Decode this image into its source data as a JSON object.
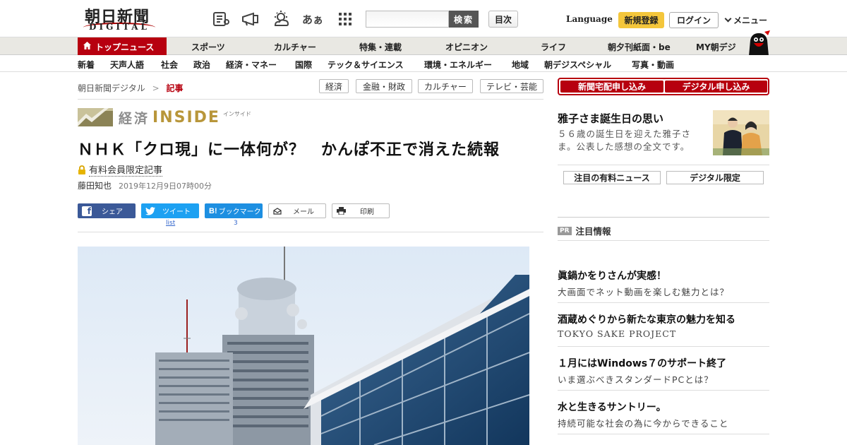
{
  "header": {
    "logo_main": "朝日新聞",
    "logo_sub": "DIGITAL",
    "hiragana_icon": "あぁ",
    "search_button": "検索",
    "toc_button": "目次",
    "language": "Language",
    "signup": "新規登録",
    "login": "ログイン",
    "menu": "メニュー"
  },
  "nav_primary": {
    "active": "トップニュース",
    "items": [
      "スポーツ",
      "カルチャー",
      "特集・連載",
      "オピニオン",
      "ライフ",
      "朝夕刊紙面・be",
      "MY朝デジ"
    ]
  },
  "nav_secondary": {
    "items": [
      "新着",
      "天声人語",
      "社会",
      "政治",
      "経済・マネー",
      "国際",
      "テック＆サイエンス",
      "環境・エネルギー",
      "地域",
      "朝デジスペシャル",
      "写真・動画"
    ]
  },
  "breadcrumb": {
    "home": "朝日新聞デジタル",
    "sep": ">",
    "current": "記事"
  },
  "tags": [
    "経済",
    "金融・財政",
    "カルチャー",
    "テレビ・芸能"
  ],
  "article": {
    "section_label": "経済",
    "section_brand": "INSIDE",
    "section_kana": "インサイド",
    "title": "ＮＨＫ「クロ現」に一体何が？　かんぽ不正で消えた続報",
    "paid_label": "有料会員限定記事",
    "author": "藤田知也",
    "date": "2019年12月9日07時00分"
  },
  "share": {
    "facebook": "シェア",
    "twitter": "ツイート",
    "hatena_logo": "B!",
    "hatena": "ブックマーク",
    "mail": "メール",
    "print": "印刷",
    "twitter_count": "list",
    "hatena_count": "3"
  },
  "sidebar": {
    "subscribe_paper": "新聞宅配申し込み",
    "subscribe_digital": "デジタル申し込み",
    "feature": {
      "title": "雅子さま誕生日の思い",
      "desc": "５６歳の誕生日を迎えた雅子さま。公表した感想の全文です。"
    },
    "tab_paid": "注目の有料ニュース",
    "tab_digital": "デジタル限定",
    "pr_badge": "PR",
    "pr_heading": "注目情報",
    "ads": [
      {
        "title": "眞鍋かをりさんが実感！",
        "sub": "大画面でネット動画を楽しむ魅力とは？"
      },
      {
        "title": "酒蔵めぐりから新たな東京の魅力を知る",
        "sub": "TOKYO SAKE PROJECT"
      },
      {
        "title": "１月にはWindows７のサポート終了",
        "sub": "いま選ぶべきスタンダードPCとは？"
      },
      {
        "title": "水と生きるサントリー。",
        "sub": "持続可能な社会の為に今からできること"
      }
    ]
  },
  "colors": {
    "brand_red": "#b7000f",
    "signup_yellow": "#f4c63b",
    "facebook": "#3b5998",
    "twitter": "#1da1f2",
    "hatena": "#1d8fe1"
  },
  "icons": [
    "newspaper-icon",
    "megaphone-icon",
    "weather-icon",
    "hiragana-icon",
    "grid-apps-icon",
    "home-icon",
    "chevron-down-icon",
    "lock-icon",
    "facebook-icon",
    "twitter-icon",
    "hatena-icon",
    "mail-icon",
    "print-icon"
  ]
}
